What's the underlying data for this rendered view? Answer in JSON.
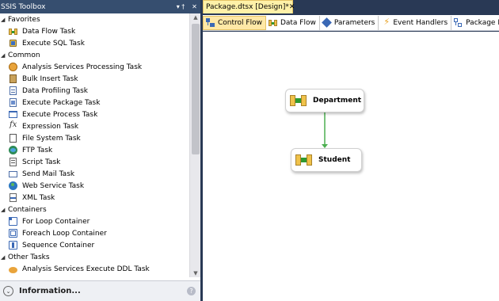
{
  "toolbox": {
    "title": "SSIS Toolbox",
    "pin_glyph": "▾ †",
    "close_glyph": "✕",
    "groups": [
      {
        "label": "Favorites",
        "items": [
          {
            "label": "Data Flow Task",
            "icon": "data-flow-icon"
          },
          {
            "label": "Execute SQL Task",
            "icon": "execute-sql-icon"
          }
        ]
      },
      {
        "label": "Common",
        "items": [
          {
            "label": "Analysis Services Processing Task",
            "icon": "analysis-services-icon"
          },
          {
            "label": "Bulk Insert Task",
            "icon": "bulk-insert-icon"
          },
          {
            "label": "Data Profiling Task",
            "icon": "data-profiling-icon"
          },
          {
            "label": "Execute Package Task",
            "icon": "execute-package-icon"
          },
          {
            "label": "Execute Process Task",
            "icon": "execute-process-icon"
          },
          {
            "label": "Expression Task",
            "icon": "expression-icon"
          },
          {
            "label": "File System Task",
            "icon": "file-system-icon"
          },
          {
            "label": "FTP Task",
            "icon": "ftp-icon"
          },
          {
            "label": "Script Task",
            "icon": "script-icon"
          },
          {
            "label": "Send Mail Task",
            "icon": "send-mail-icon"
          },
          {
            "label": "Web Service Task",
            "icon": "web-service-icon"
          },
          {
            "label": "XML Task",
            "icon": "xml-icon"
          }
        ]
      },
      {
        "label": "Containers",
        "items": [
          {
            "label": "For Loop Container",
            "icon": "for-loop-icon"
          },
          {
            "label": "Foreach Loop Container",
            "icon": "foreach-loop-icon"
          },
          {
            "label": "Sequence Container",
            "icon": "sequence-icon"
          }
        ]
      },
      {
        "label": "Other Tasks",
        "items": [
          {
            "label": "Analysis Services Execute DDL Task",
            "icon": "analysis-ddl-icon"
          }
        ]
      }
    ]
  },
  "information": {
    "label": "Information...",
    "help_glyph": "?"
  },
  "document_tab": {
    "label": "Package.dtsx [Design]*",
    "close_glyph": "✕"
  },
  "designer_tabs": [
    {
      "label": "Control Flow",
      "icon": "control-flow-icon",
      "active": true
    },
    {
      "label": "Data Flow",
      "icon": "data-flow-icon",
      "active": false
    },
    {
      "label": "Parameters",
      "icon": "parameters-icon",
      "active": false
    },
    {
      "label": "Event Handlers",
      "icon": "event-handlers-icon",
      "active": false
    },
    {
      "label": "Package Explorer",
      "icon": "package-explorer-icon",
      "active": false
    }
  ],
  "tasks": [
    {
      "label": "Department",
      "icon": "data-flow-task-icon"
    },
    {
      "label": "Student",
      "icon": "data-flow-task-icon"
    }
  ],
  "colors": {
    "precedence_constraint": "#4caf50",
    "header_bg": "#364e6f",
    "active_tab": "#ffe8a6"
  }
}
